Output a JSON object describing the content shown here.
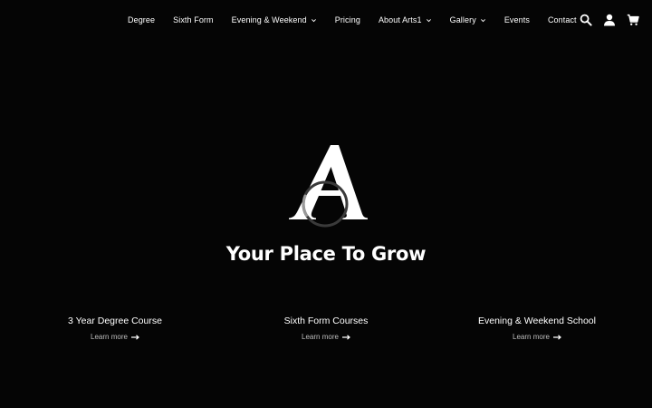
{
  "colors": {
    "background": "#050505",
    "text": "#ffffff",
    "muted": "#bdbdbd"
  },
  "nav": {
    "items": [
      {
        "label": "Degree",
        "has_dropdown": false
      },
      {
        "label": "Sixth Form",
        "has_dropdown": false
      },
      {
        "label": "Evening & Weekend",
        "has_dropdown": true
      },
      {
        "label": "Pricing",
        "has_dropdown": false
      },
      {
        "label": "About Arts1",
        "has_dropdown": true
      },
      {
        "label": "Gallery",
        "has_dropdown": true
      },
      {
        "label": "Events",
        "has_dropdown": false
      },
      {
        "label": "Contact",
        "has_dropdown": false
      }
    ],
    "icons": [
      "search-icon",
      "account-icon",
      "cart-icon"
    ]
  },
  "hero": {
    "title": "Your Place To Grow"
  },
  "cards": [
    {
      "title": "3 Year Degree Course",
      "link": "Learn more"
    },
    {
      "title": "Sixth Form Courses",
      "link": "Learn more"
    },
    {
      "title": "Evening & Weekend School",
      "link": "Learn more"
    }
  ]
}
